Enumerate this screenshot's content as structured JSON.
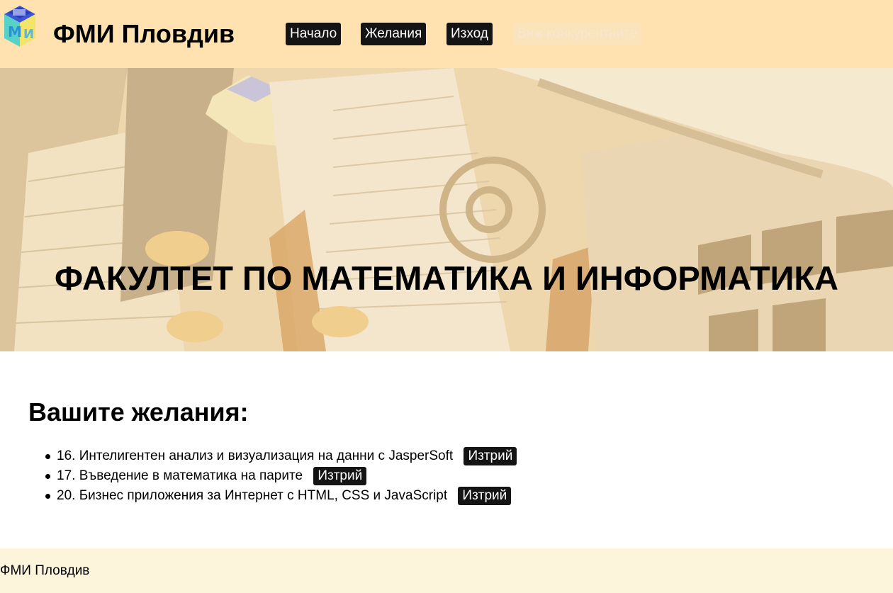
{
  "header": {
    "site_title": "ФМИ Пловдив",
    "nav": [
      {
        "label": "Начало"
      },
      {
        "label": "Желания"
      },
      {
        "label": "Изход"
      },
      {
        "label": "Виж конкурентните"
      }
    ]
  },
  "hero": {
    "title": "ФАКУЛТЕТ ПО МАТЕМАТИКА И ИНФОРМАТИКА"
  },
  "main": {
    "heading": "Вашите желания:",
    "wishes": [
      {
        "text": "16. Интелигентен анализ и визуализация на данни с JasperSoft",
        "action": "Изтрий"
      },
      {
        "text": "17. Въведение в математика на парите",
        "action": "Изтрий"
      },
      {
        "text": "20. Бизнес приложения за Интернет с HTML, CSS и JavaScript",
        "action": "Изтрий"
      }
    ]
  },
  "footer": {
    "text": "ФМИ Пловдив"
  },
  "colors": {
    "header_bg": "#ffe2b0",
    "button_bg": "#141414",
    "footer_bg": "#fdf4dc"
  }
}
